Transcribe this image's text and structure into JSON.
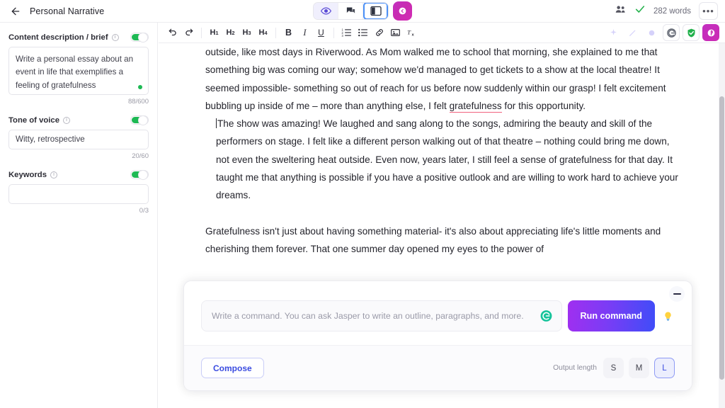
{
  "topbar": {
    "back_icon": "arrow-left-icon",
    "title": "Personal Narrative",
    "view_buttons": [
      {
        "name": "preview-eye-icon",
        "state": "active"
      },
      {
        "name": "comments-icon",
        "state": "default"
      },
      {
        "name": "split-panel-icon",
        "state": "selected"
      }
    ],
    "collapse_icon": "chevron-left-circle-icon",
    "team_icon": "team-members-icon",
    "saved_icon": "check-saved-icon",
    "word_count": "282 words",
    "more_label": "•••"
  },
  "sidebar": {
    "fields": [
      {
        "label": "Content description / brief",
        "info_icon": "info-icon",
        "toggle": "on",
        "value": "Write a personal essay about an event in life that exemplifies a feeling of gratefulness",
        "placeholder": "",
        "counter": "88/600",
        "status_dot": true
      },
      {
        "label": "Tone of voice",
        "info_icon": "info-icon",
        "toggle": "on",
        "value": "Witty, retrospective",
        "placeholder": "",
        "counter": "20/60",
        "status_dot": false
      },
      {
        "label": "Keywords",
        "info_icon": "info-icon",
        "toggle": "on",
        "value": "",
        "placeholder": "",
        "counter": "0/3",
        "status_dot": false
      }
    ]
  },
  "editor_toolbar": {
    "undo": "undo-icon",
    "redo": "redo-icon",
    "headings": [
      "H1",
      "H2",
      "H3",
      "H4"
    ],
    "bold": "B",
    "italic": "I",
    "underline": "U",
    "ordered_list": "numbered-list-icon",
    "bullet_list": "bullet-list-icon",
    "link": "link-icon",
    "image": "image-icon",
    "clear_format": "clear-formatting-icon",
    "right_icons": [
      "sparkle-icon",
      "magic-wand-icon",
      "circle-icon",
      "grammarly-icon",
      "shield-check-icon",
      "jasper-icon"
    ]
  },
  "document": {
    "paragraphs": [
      {
        "id": "p1",
        "indent": false,
        "caret": false,
        "segments": [
          {
            "text": "outside, like most days in Riverwood. As Mom walked me to school that morning, she explained to me that something big was coming our way; somehow we'd managed to get tickets to a show at the local theatre! It seemed impossible- something so out of reach for us before now suddenly within our grasp! I felt excitement bubbling up inside of me – more than anything else, I felt ",
            "style": "normal"
          },
          {
            "text": "gratefulness",
            "style": "misspelled"
          },
          {
            "text": " for this opportunity.",
            "style": "normal"
          }
        ]
      },
      {
        "id": "p2",
        "indent": true,
        "caret": true,
        "segments": [
          {
            "text": "The show was amazing! We laughed and sang along to the songs, admiring the beauty and skill of the performers on stage. I felt like a different person walking out of that theatre – nothing could bring me down, not even the sweltering heat outside. Even now, years later, I still feel a sense of gratefulness for that day. It taught me that anything is possible if you have a positive outlook and are willing to work hard to achieve your dreams.",
            "style": "normal"
          }
        ]
      },
      {
        "id": "p3",
        "indent": false,
        "caret": false,
        "segments": [
          {
            "text": "Gratefulness isn't just about having something material- it's also about appreciating life's little moments and cherishing them forever. That one summer day opened my eyes to the power of",
            "style": "normal"
          }
        ]
      }
    ]
  },
  "command_panel": {
    "minimize_icon": "minimize-icon",
    "input_placeholder": "Write a command. You can ask Jasper to write an outline, paragraphs, and more.",
    "input_value": "",
    "grammarly_icon": "grammarly-icon",
    "run_label": "Run command",
    "hint_icon": "lightbulb-icon",
    "compose_label": "Compose",
    "output_length_label": "Output length",
    "output_lengths": [
      {
        "label": "S",
        "selected": false
      },
      {
        "label": "M",
        "selected": false
      },
      {
        "label": "L",
        "selected": true
      }
    ]
  },
  "colors": {
    "accent_purple": "#7b3cf5",
    "accent_blue": "#3f4df8",
    "magenta": "#c92bb0",
    "green": "#1db954",
    "misspell_underline": "#f0627e",
    "selected_outline": "#4b90f7"
  }
}
